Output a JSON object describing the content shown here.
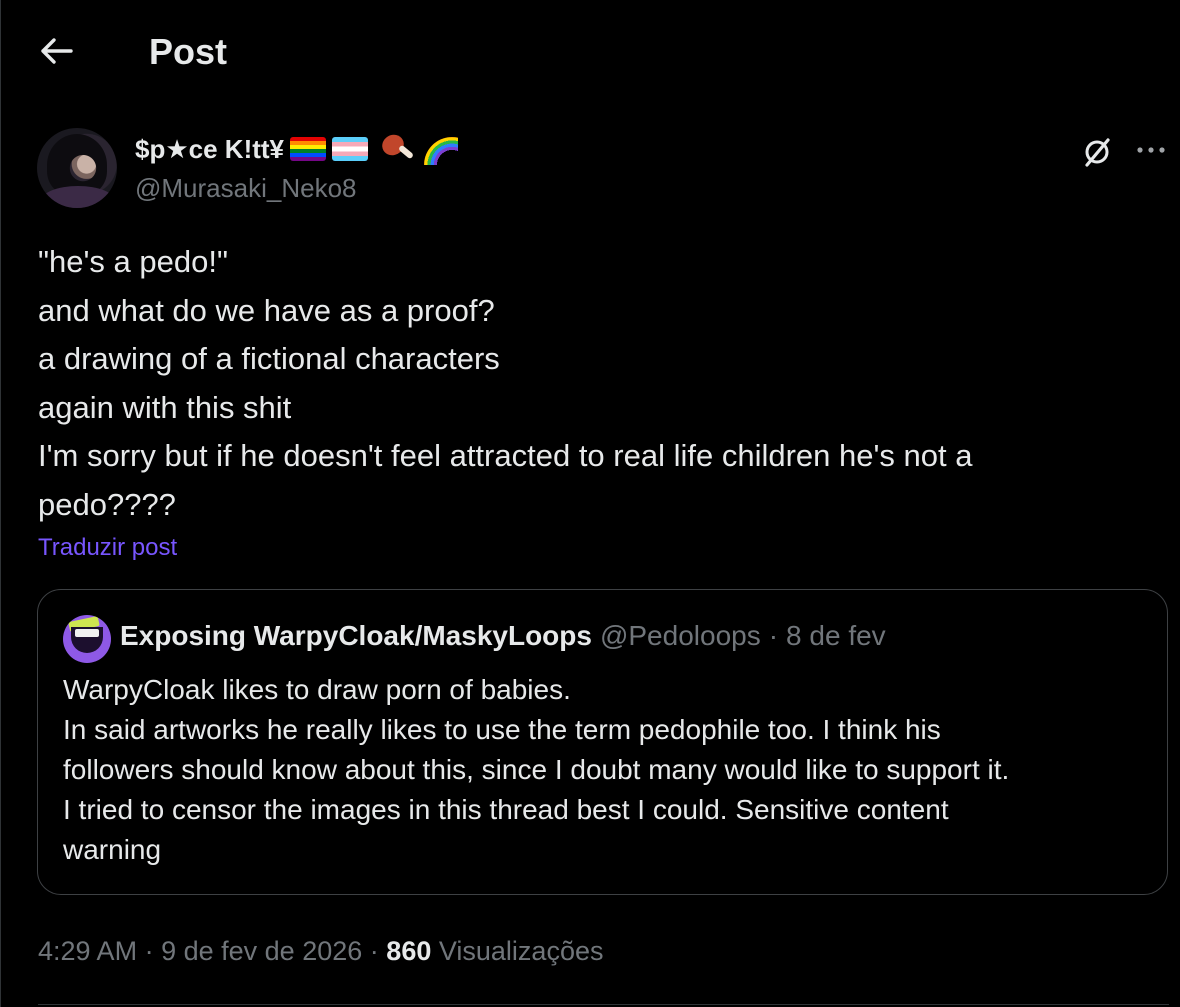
{
  "header": {
    "title": "Post",
    "back_icon": "arrow-left-icon"
  },
  "post": {
    "author": {
      "display_name": "$p★ce K!tt¥",
      "handle": "@Murasaki_Neko8",
      "name_emojis": [
        "rainbow-flag",
        "transgender-flag",
        "meat-on-bone",
        "rainbow"
      ]
    },
    "body_lines": [
      "\"he's a pedo!\"",
      "and what do we have as a proof?",
      "a drawing of a fictional characters",
      "again with this shit",
      "I'm sorry but if he doesn't feel attracted to real life children he's not a",
      "pedo????"
    ],
    "translate_label": "Traduzir post",
    "quote": {
      "display_name": "Exposing WarpyCloak/MaskyLoops",
      "handle": "@Pedoloops",
      "separator": "·",
      "date": "8 de fev",
      "text_lines": [
        "WarpyCloak likes to draw porn of babies.",
        "In said artworks he really likes to use the term pedophile too. I think his",
        "followers should know about this, since I doubt many would like to support it.",
        "I tried to censor the images in this thread best I could. Sensitive content",
        "warning"
      ]
    },
    "meta": {
      "time": "4:29 AM",
      "separator": "·",
      "date": "9 de fev de 2026",
      "views_count": "860",
      "views_label": "Visualizações"
    }
  },
  "colors": {
    "background": "#000000",
    "text_primary": "#e7e9ea",
    "text_secondary": "#71767b",
    "link": "#7856ff",
    "border": "#3e4144"
  }
}
